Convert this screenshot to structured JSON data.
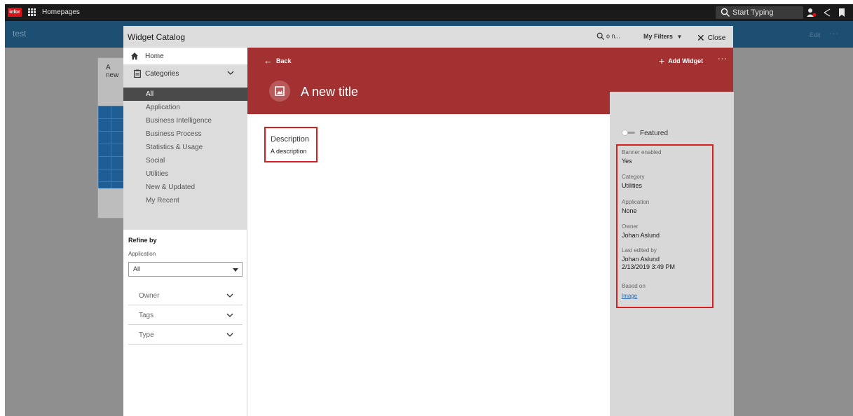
{
  "topbar": {
    "logo_text": "infor",
    "app_title": "Homepages",
    "search_placeholder": "Start Typing"
  },
  "homepage": {
    "page_name": "test",
    "edit_label": "Edit",
    "more_label": "···",
    "card_title": "A new"
  },
  "modal": {
    "title": "Widget Catalog",
    "search_label": "o n...",
    "filters_label": "My Filters",
    "close_label": "Close"
  },
  "leftnav": {
    "home_label": "Home",
    "categories_label": "Categories",
    "categories": [
      {
        "label": "All",
        "selected": true
      },
      {
        "label": "Application"
      },
      {
        "label": "Business Intelligence"
      },
      {
        "label": "Business Process"
      },
      {
        "label": "Statistics & Usage"
      },
      {
        "label": "Social"
      },
      {
        "label": "Utilities"
      },
      {
        "label": "New & Updated"
      },
      {
        "label": "My Recent"
      }
    ],
    "refine_label": "Refine by",
    "application_label": "Application",
    "application_value": "All",
    "accordions": [
      {
        "label": "Owner"
      },
      {
        "label": "Tags"
      },
      {
        "label": "Type"
      }
    ]
  },
  "main": {
    "back_label": "Back",
    "add_widget_label": "Add Widget",
    "more_label": "···",
    "title": "A new title",
    "banner_color": "#a33131",
    "description_heading": "Description",
    "description_text": "A description"
  },
  "details": {
    "featured_label": "Featured",
    "featured_on": false,
    "banner_enabled": {
      "label": "Banner enabled",
      "value": "Yes"
    },
    "category": {
      "label": "Category",
      "value": "Utilities"
    },
    "application": {
      "label": "Application",
      "value": "None"
    },
    "owner": {
      "label": "Owner",
      "value": "Johan Aslund"
    },
    "last_edited": {
      "label": "Last edited by",
      "value": "Johan Aslund",
      "date": "2/13/2019 3:49 PM"
    },
    "based_on": {
      "label": "Based on",
      "value": "Image"
    }
  },
  "colors": {
    "highlight": "#d61f1f",
    "selected_nav": "#4a4a4a",
    "link": "#2f6fb5"
  }
}
